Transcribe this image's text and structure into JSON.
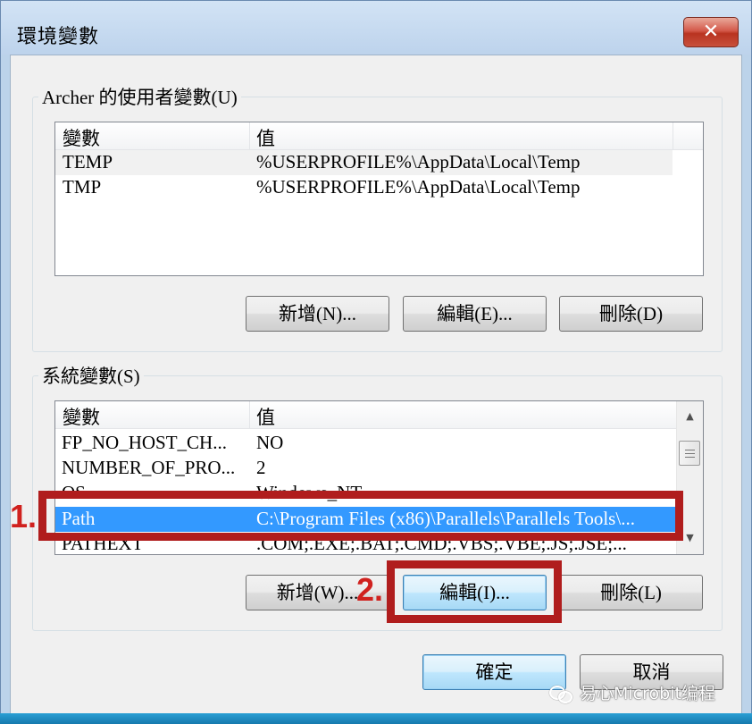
{
  "window": {
    "title": "環境變數",
    "close_label": "✕"
  },
  "user_vars": {
    "group_label": "Archer 的使用者變數(U)",
    "columns": [
      "變數",
      "值"
    ],
    "rows": [
      {
        "name": "TEMP",
        "value": "%USERPROFILE%\\AppData\\Local\\Temp"
      },
      {
        "name": "TMP",
        "value": "%USERPROFILE%\\AppData\\Local\\Temp"
      }
    ],
    "buttons": {
      "new": "新增(N)...",
      "edit": "編輯(E)...",
      "delete": "刪除(D)"
    }
  },
  "system_vars": {
    "group_label": "系統變數(S)",
    "columns": [
      "變數",
      "值"
    ],
    "rows": [
      {
        "name": "FP_NO_HOST_CH...",
        "value": "NO"
      },
      {
        "name": "NUMBER_OF_PRO...",
        "value": "2"
      },
      {
        "name": "OS",
        "value": "Windows_NT"
      },
      {
        "name": "Path",
        "value": "C:\\Program Files (x86)\\Parallels\\Parallels Tools\\..."
      },
      {
        "name": "PATHEXT",
        "value": ".COM;.EXE;.BAT;.CMD;.VBS;.VBE;.JS;.JSE;..."
      }
    ],
    "selected_row": "Path",
    "buttons": {
      "new": "新增(W)...",
      "edit": "編輯(I)...",
      "delete": "刪除(L)"
    }
  },
  "dialog_buttons": {
    "ok": "確定",
    "cancel": "取消"
  },
  "annotations": {
    "step1": "1.",
    "step2": "2.",
    "highlight_color": "#b01d1d"
  },
  "watermark": {
    "text": "易心Microbit编程"
  },
  "icons": [
    "close-icon",
    "scroll-up-arrow-icon",
    "scroll-down-arrow-icon",
    "scroll-thumb-grip-icon",
    "wechat-icon"
  ]
}
